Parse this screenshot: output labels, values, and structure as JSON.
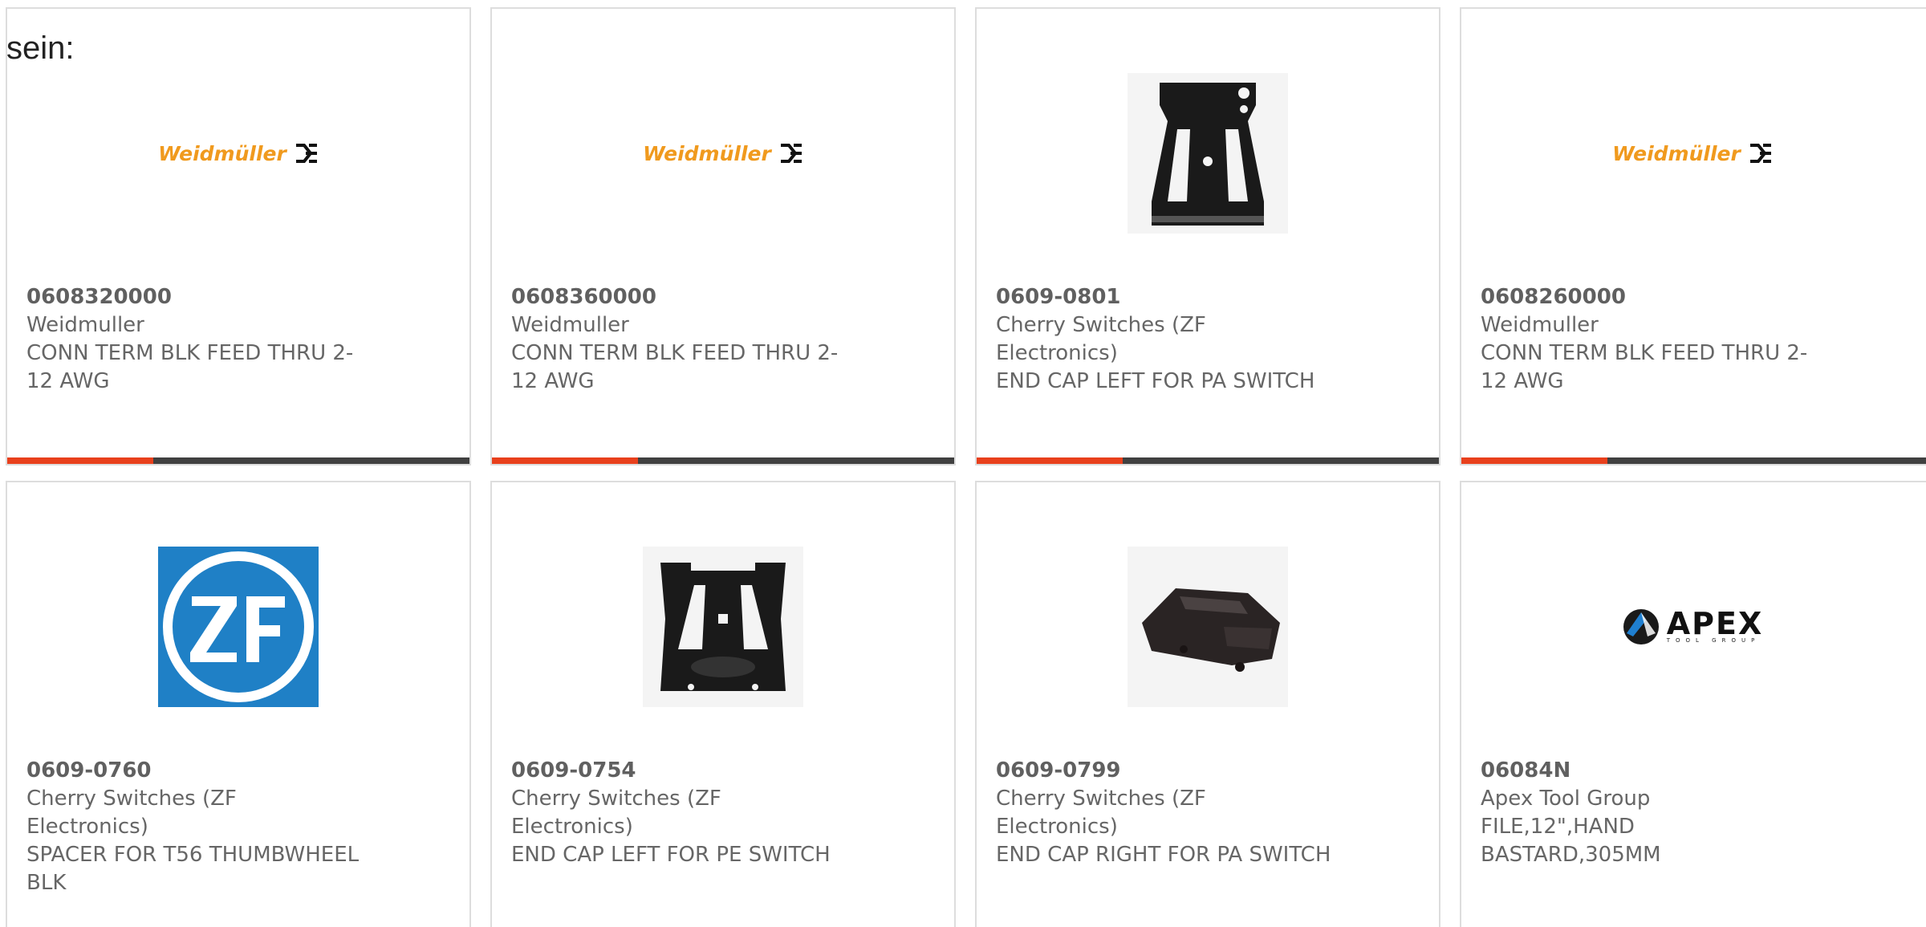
{
  "intro_text": "sein:",
  "brand_colors": {
    "accent_bar": "#e8401c",
    "dark_bar": "#404040",
    "weidmuller_orange": "#f09a1e",
    "zf_blue": "#1f80c6"
  },
  "products": [
    {
      "part_number": "0608320000",
      "manufacturer": "Weidmuller",
      "description": "CONN TERM BLK FEED THRU 2-12 AWG",
      "image": "weidmuller-logo",
      "logo_text": "Weidmüller"
    },
    {
      "part_number": "0608360000",
      "manufacturer": "Weidmuller",
      "description": "CONN TERM BLK FEED THRU 2-12 AWG",
      "image": "weidmuller-logo",
      "logo_text": "Weidmüller"
    },
    {
      "part_number": "0609-0801",
      "manufacturer": "Cherry Switches (ZF Electronics)",
      "description": "END CAP LEFT FOR PA SWITCH",
      "image": "end-cap-photo"
    },
    {
      "part_number": "0608260000",
      "manufacturer": "Weidmuller",
      "description": "CONN TERM BLK FEED THRU 2-12 AWG",
      "image": "weidmuller-logo",
      "logo_text": "Weidmüller"
    },
    {
      "part_number": "0609-0760",
      "manufacturer": "Cherry Switches (ZF Electronics)",
      "description": "SPACER FOR T56 THUMBWHEEL BLK",
      "image": "zf-logo",
      "logo_text": "ZF"
    },
    {
      "part_number": "0609-0754",
      "manufacturer": "Cherry Switches (ZF Electronics)",
      "description": "END CAP LEFT FOR PE SWITCH",
      "image": "end-cap-pe-photo"
    },
    {
      "part_number": "0609-0799",
      "manufacturer": "Cherry Switches (ZF Electronics)",
      "description": "END CAP RIGHT FOR PA SWITCH",
      "image": "end-cap-right-photo"
    },
    {
      "part_number": "06084N",
      "manufacturer": "Apex Tool Group",
      "description": "FILE,12\",HAND BASTARD,305MM",
      "image": "apex-logo",
      "logo_text": "APEX",
      "logo_subtext": "TOOL GROUP"
    }
  ]
}
